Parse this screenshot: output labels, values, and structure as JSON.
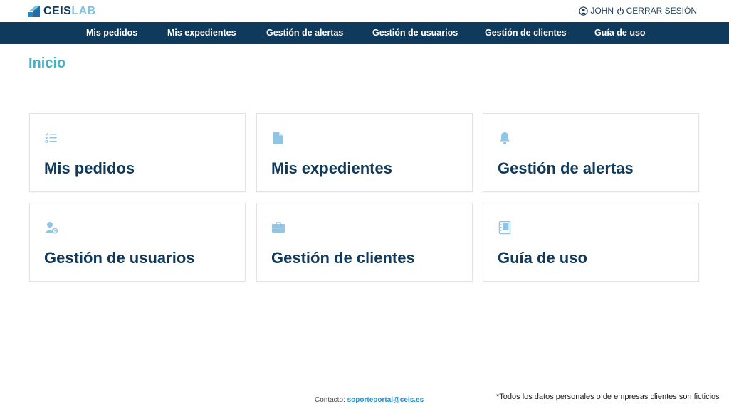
{
  "brand": {
    "part1": "CEIS",
    "part2": "LAB"
  },
  "header": {
    "user_name": "JOHN",
    "logout_label": "CERRAR SESIÓN"
  },
  "nav": {
    "items": [
      {
        "label": "Mis pedidos"
      },
      {
        "label": "Mis expedientes"
      },
      {
        "label": "Gestión de alertas"
      },
      {
        "label": "Gestión de usuarios"
      },
      {
        "label": "Gestión de clientes"
      },
      {
        "label": "Guía de uso"
      }
    ]
  },
  "page": {
    "title": "Inicio"
  },
  "cards": [
    {
      "title": "Mis pedidos",
      "icon": "checklist-icon"
    },
    {
      "title": "Mis expedientes",
      "icon": "document-icon"
    },
    {
      "title": "Gestión de alertas",
      "icon": "bell-icon"
    },
    {
      "title": "Gestión de usuarios",
      "icon": "user-gear-icon"
    },
    {
      "title": "Gestión de clientes",
      "icon": "briefcase-icon"
    },
    {
      "title": "Guía de uso",
      "icon": "notebook-icon"
    }
  ],
  "footer": {
    "contact_label": "Contacto:",
    "contact_email": "soporteportal@ceis.es",
    "note": "*Todos los datos personales o de empresas clientes son ficticios"
  },
  "colors": {
    "primary": "#0f3a5c",
    "accent": "#43b2c9",
    "icon": "#8fc6e6"
  }
}
